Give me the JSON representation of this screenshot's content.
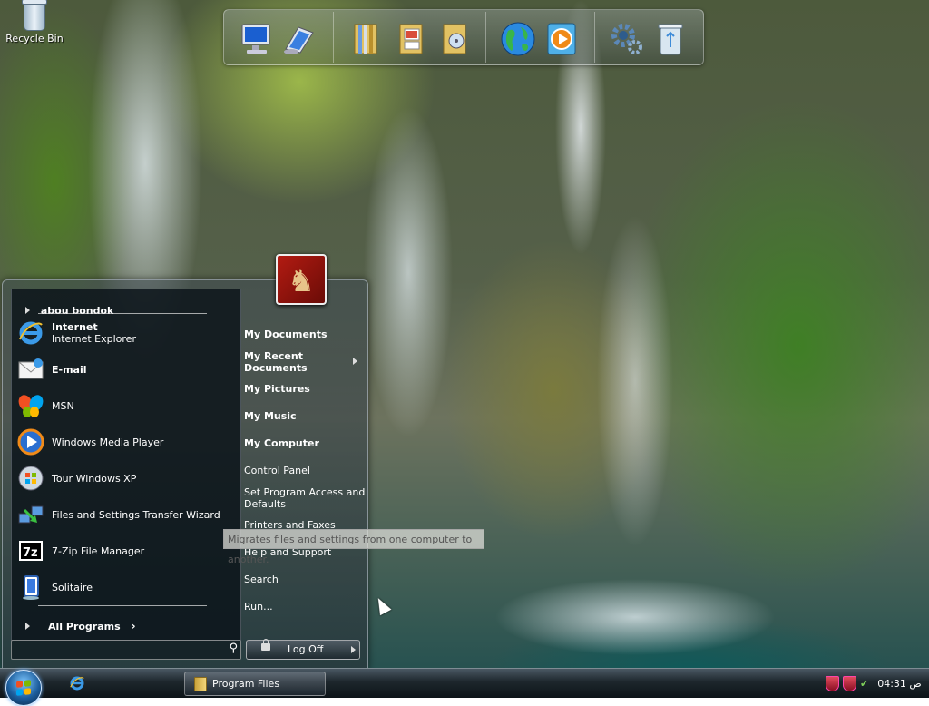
{
  "desktop": {
    "icons": [
      {
        "label": "Recycle Bin",
        "icon": "recycle-bin-icon"
      }
    ]
  },
  "dock": {
    "icons": [
      "monitor-icon",
      "network-computer-icon",
      "folder-books-icon",
      "pictures-folder-icon",
      "music-folder-icon",
      "globe-icon",
      "media-player-icon",
      "settings-gears-icon",
      "recycle-bin-icon"
    ]
  },
  "start_menu": {
    "user_name": "abou bondok",
    "user_picture": "chess-icon",
    "pinned": [
      {
        "title": "Internet",
        "subtitle": "Internet Explorer",
        "icon": "internet-explorer-icon"
      },
      {
        "title": "E-mail",
        "subtitle": "",
        "icon": "email-icon"
      }
    ],
    "recent": [
      {
        "label": "MSN",
        "icon": "msn-butterfly-icon"
      },
      {
        "label": "Windows Media Player",
        "icon": "media-player-icon"
      },
      {
        "label": "Tour Windows XP",
        "icon": "tour-windows-icon"
      },
      {
        "label": "Files and Settings Transfer Wizard",
        "icon": "transfer-wizard-icon"
      },
      {
        "label": "7-Zip File Manager",
        "icon": "seven-zip-icon"
      },
      {
        "label": "Solitaire",
        "icon": "solitaire-icon"
      }
    ],
    "all_programs": "All Programs",
    "right_pane": {
      "my_documents": "My Documents",
      "my_recent_documents_line1": "My Recent",
      "my_recent_documents_line2": "Documents",
      "my_pictures": "My Pictures",
      "my_music": "My Music",
      "my_computer": "My Computer",
      "control_panel": "Control Panel",
      "set_program_line1": "Set Program Access and",
      "set_program_line2": "Defaults",
      "printers_and_faxes": "Printers and Faxes",
      "help_and_support": "Help and Support",
      "search": "Search",
      "run": "Run..."
    },
    "search_placeholder": "",
    "log_off": "Log Off",
    "tooltip": "Migrates files and settings from one computer to another."
  },
  "taskbar": {
    "tasks": [
      {
        "label": "Program Files",
        "icon": "folder-icon"
      }
    ],
    "clock": "04:31 ص"
  },
  "colors": {
    "windows_flag": [
      "#f25022",
      "#7fba00",
      "#00a4ef",
      "#ffb900"
    ]
  }
}
